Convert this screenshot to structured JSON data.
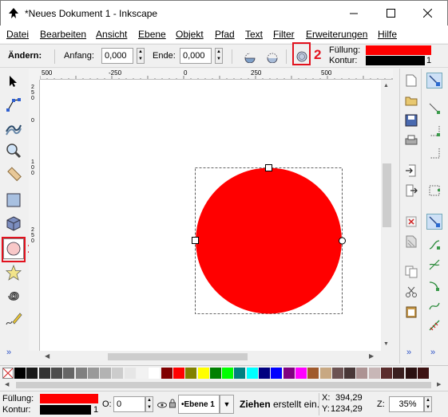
{
  "window": {
    "title": "*Neues Dokument 1 - Inkscape",
    "minimize": "—",
    "maximize": "☐",
    "close": "✕"
  },
  "menu": [
    "Datei",
    "Bearbeiten",
    "Ansicht",
    "Ebene",
    "Objekt",
    "Pfad",
    "Text",
    "Filter",
    "Erweiterungen",
    "Hilfe"
  ],
  "tool_controls": {
    "change_label": "Ändern:",
    "start_label": "Anfang:",
    "start_value": "0,000",
    "end_label": "Ende:",
    "end_value": "0,000",
    "fill_label": "Füllung:",
    "stroke_label": "Kontur:",
    "stroke_width": "1",
    "fill_color": "#ff0000",
    "stroke_color": "#000000"
  },
  "annotations": {
    "marker1": "1",
    "marker2": "2",
    "color": "#e2121e"
  },
  "ruler": {
    "h_labels": [
      "500",
      "-250",
      "0",
      "250",
      "500"
    ],
    "v_labels": [
      "2\n5\n0",
      "0",
      "1\n0\n0",
      "2\n5\n0"
    ]
  },
  "tools": [
    "selector-icon",
    "node-icon",
    "tweak-icon",
    "zoom-icon",
    "measure-icon",
    "rect-icon",
    "3dbox-icon",
    "ellipse-icon",
    "star-icon",
    "spiral-icon",
    "pencil-icon"
  ],
  "palette_colors": [
    "#000000",
    "#1a1a1a",
    "#333333",
    "#4d4d4d",
    "#666666",
    "#808080",
    "#999999",
    "#b3b3b3",
    "#cccccc",
    "#e6e6e6",
    "#f2f2f2",
    "#ffffff",
    "#800000",
    "#ff0000",
    "#808000",
    "#ffff00",
    "#008000",
    "#00ff00",
    "#008080",
    "#00ffff",
    "#000080",
    "#0000ff",
    "#800080",
    "#ff00ff",
    "#a05a2c",
    "#c8a882",
    "#6c5353",
    "#483737",
    "#ac9393",
    "#c8b7b7",
    "#5a2c2c",
    "#3a1f1f",
    "#2b1111",
    "#3d1212"
  ],
  "status": {
    "fill_label": "Füllung:",
    "stroke_label": "Kontur:",
    "stroke_width": "1",
    "opacity_label": "O:",
    "opacity_value": "0",
    "layer": "•Ebene 1",
    "message_bold": "Ziehen",
    "message_rest": "erstellt ein.",
    "x_label": "X:",
    "x_value": "394,29",
    "y_label": "Y:",
    "y_value": "1234,29",
    "zoom_label": "Z:",
    "zoom_value": "35%"
  }
}
